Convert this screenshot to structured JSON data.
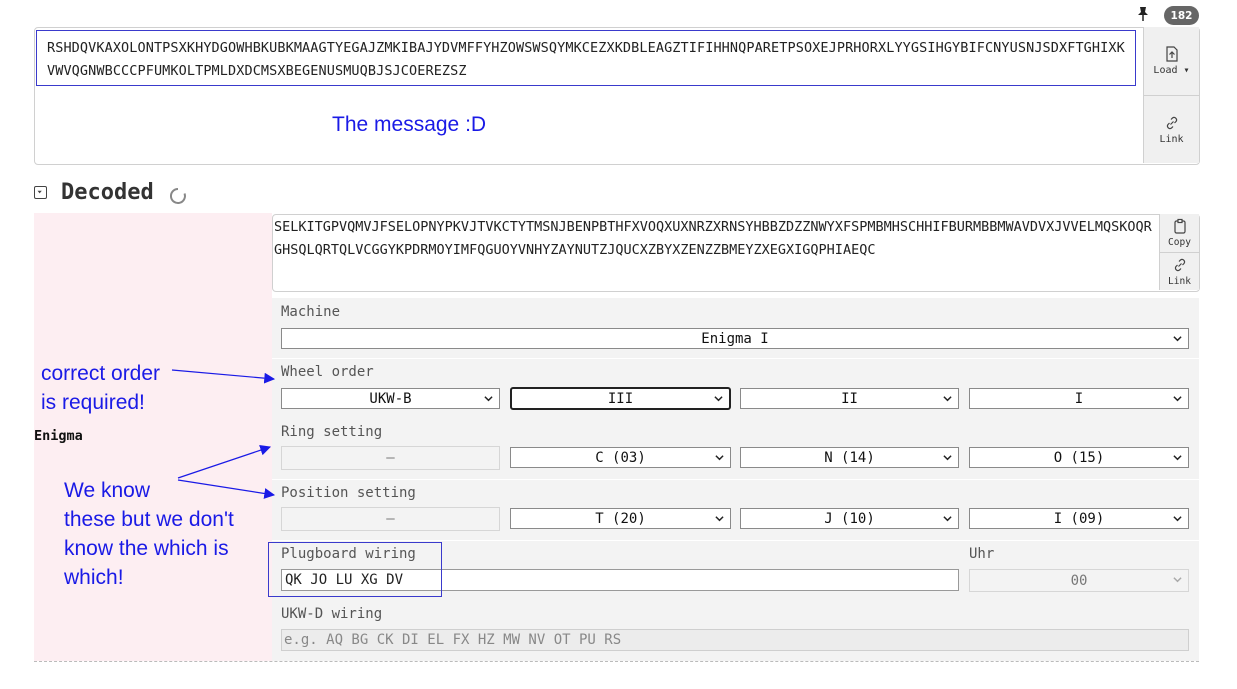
{
  "input": {
    "text": "RSHDQVKAXOLONTPSXKHYDGOWHBKUBKMAAGTYEGAJZMKIBAJYDVMFFYHZOWSWSQYMKCEZXKDBLEAGZTIFIHHNQPARETPSOXEJPRHORXLYYGSIHGYBIFCNYUSNJSDXFTGHIXKVWVQGNWBCCCPFUMKOLTPMLDXDCMSXBEGENUSMUQBJSJCOEREZSZ",
    "load_label": "Load",
    "link_label": "Link",
    "count": "182"
  },
  "annotations": {
    "message": "The message :D",
    "order_line1": "correct order",
    "order_line2": "is required!",
    "know_line1": "We know",
    "know_line2": "these but we don't",
    "know_line3": "know the which is",
    "know_line4": "which!"
  },
  "decoded": {
    "title": "Decoded",
    "operation": "Enigma",
    "text": "SELKITGPVQMVJFSELOPNYPKVJTVKCTYTMSNJBENPBTHFXVOQXUXNRZXRNSYHBBZDZZNWYXFSPMBMHSCHHIFBURMBBMWAVDVXJVVELMQSKOQRGHSQLQRTQLVCGGYKPDRMOYIMFQGUOYVNHYZAYNUTZJQUCXZBYXZENZZBMEYZXEGXIGQPHIAEQC",
    "copy_label": "Copy",
    "link_label": "Link"
  },
  "settings": {
    "machine_label": "Machine",
    "machine_value": "Enigma I",
    "wheel_order_label": "Wheel order",
    "wheels": [
      "UKW-B",
      "III",
      "II",
      "I"
    ],
    "ring_label": "Ring setting",
    "rings": [
      "–",
      "C (03)",
      "N (14)",
      "O (15)"
    ],
    "position_label": "Position setting",
    "positions": [
      "–",
      "T (20)",
      "J (10)",
      "I (09)"
    ],
    "plugboard_label": "Plugboard wiring",
    "plugboard_value": "QK JO LU XG DV",
    "uhr_label": "Uhr",
    "uhr_value": "00",
    "ukwd_label": "UKW-D wiring",
    "ukwd_placeholder": "e.g. AQ BG CK DI EL FX HZ MW NV OT PU RS"
  },
  "colors": {
    "annotation": "#1a1ae6",
    "left_panel": "#fdeef2"
  }
}
